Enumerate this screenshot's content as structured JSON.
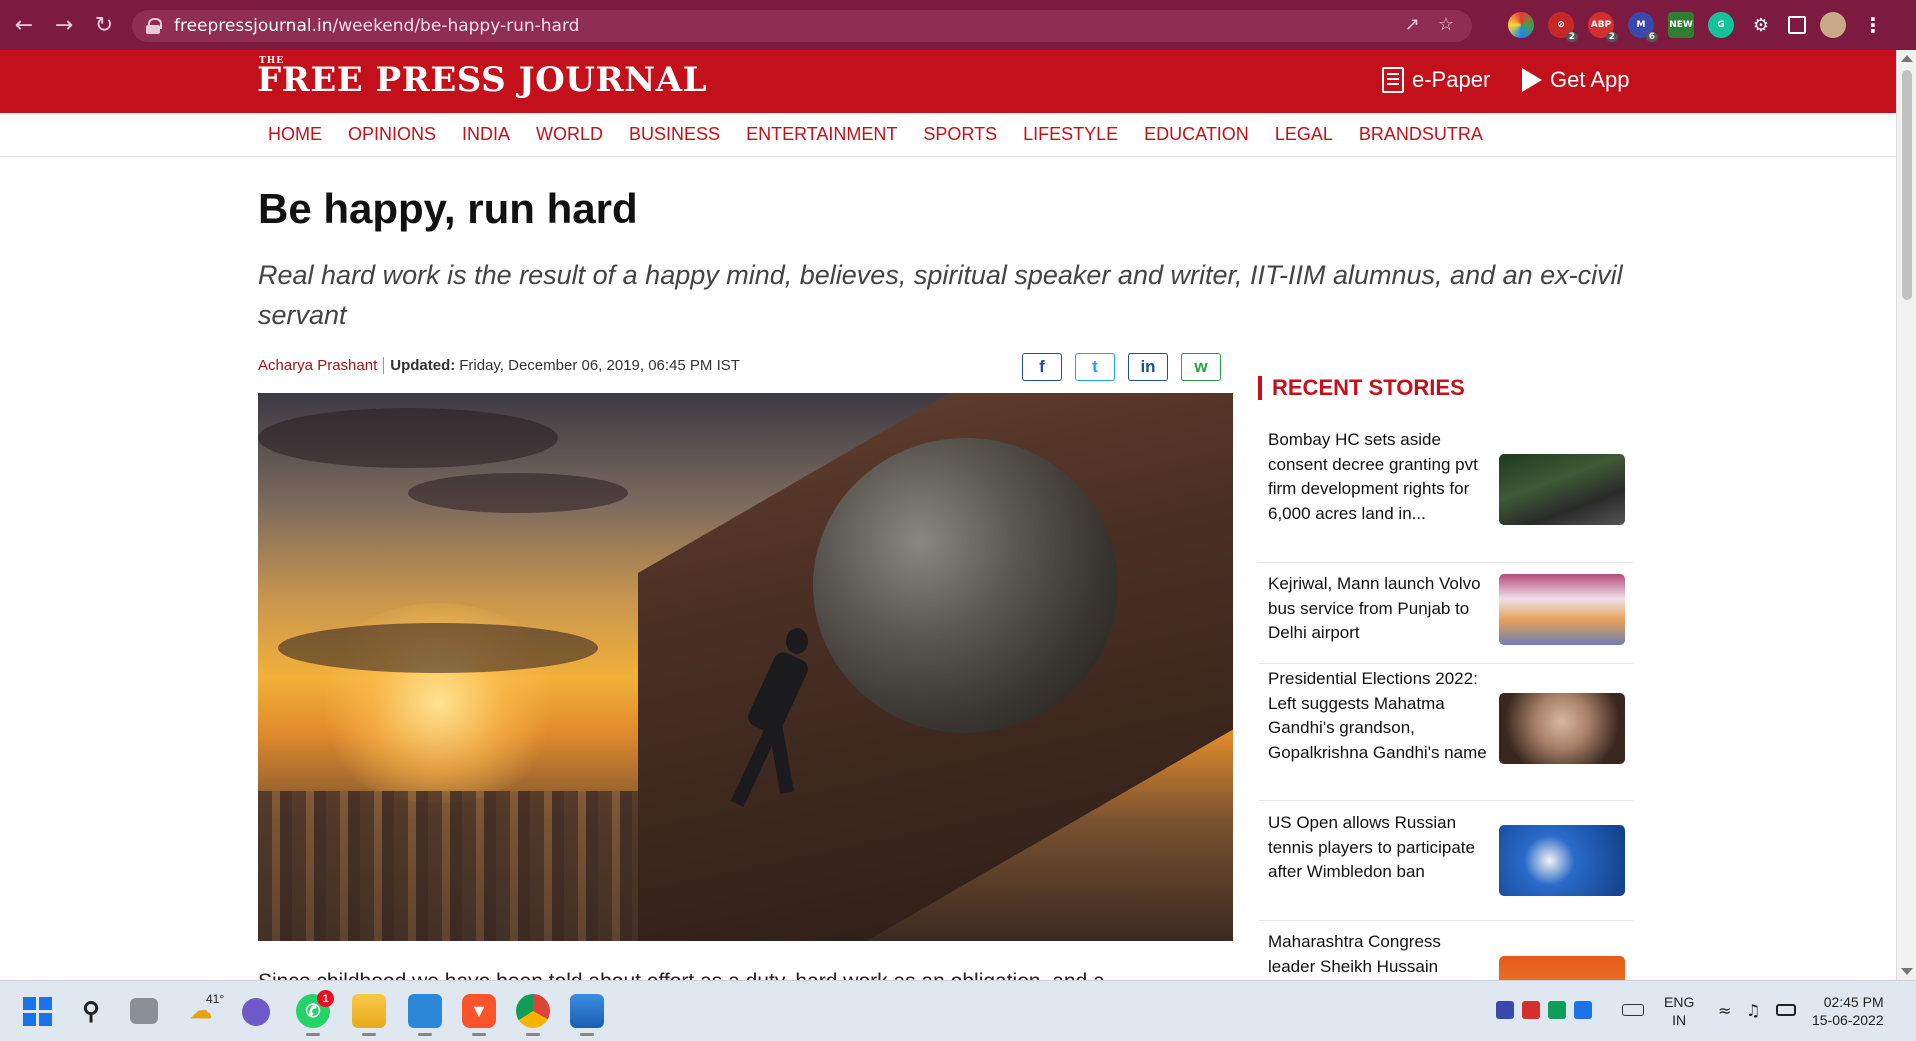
{
  "browser": {
    "url_host": "freepressjournal.in",
    "url_path": "/weekend/be-happy-run-hard",
    "ext_badges": [
      "2",
      "2",
      "6"
    ],
    "ext_new_label": "NEW",
    "ext_abp_label": "ABP"
  },
  "site": {
    "logo_the": "THE",
    "logo": "FREE PRESS JOURNAL",
    "epaper_label": "e-Paper",
    "getapp_label": "Get App",
    "brand_color": "#c4101a"
  },
  "nav": {
    "items": [
      "HOME",
      "OPINIONS",
      "INDIA",
      "WORLD",
      "BUSINESS",
      "ENTERTAINMENT",
      "SPORTS",
      "LIFESTYLE",
      "EDUCATION",
      "LEGAL",
      "BRANDSUTRA"
    ]
  },
  "article": {
    "title": "Be happy, run hard",
    "subtitle": "Real hard work is the result of a happy mind, believes, spiritual speaker and writer, IIT-IIM alumnus, and an ex-civil servant",
    "author": "Acharya Prashant",
    "updated_label": "Updated:",
    "updated_value": "Friday, December 06, 2019, 06:45 PM IST",
    "share": {
      "facebook": "f",
      "twitter": "t",
      "linkedin": "in",
      "whatsapp": "w"
    },
    "body_first_line": "Since childhood we have been told about effort as a duty, hard work as an obligation, and a"
  },
  "sidebar": {
    "title": "RECENT STORIES",
    "stories": [
      {
        "text": "Bombay HC sets aside consent decree granting pvt firm development rights for 6,000 acres land in..."
      },
      {
        "text": "Kejriwal, Mann launch Volvo bus service from Punjab to Delhi airport"
      },
      {
        "text": "Presidential Elections 2022: Left suggests Mahatma Gandhi's grandson, Gopalkrishna Gandhi's name"
      },
      {
        "text": "US Open allows Russian tennis players to participate after Wimbledon ban"
      },
      {
        "text": "Maharashtra Congress leader Sheikh Hussain"
      }
    ]
  },
  "taskbar": {
    "weather_temp": "41°",
    "whatsapp_badge": "1",
    "lang_line1": "ENG",
    "lang_line2": "IN",
    "time": "02:45 PM",
    "date": "15-06-2022"
  }
}
